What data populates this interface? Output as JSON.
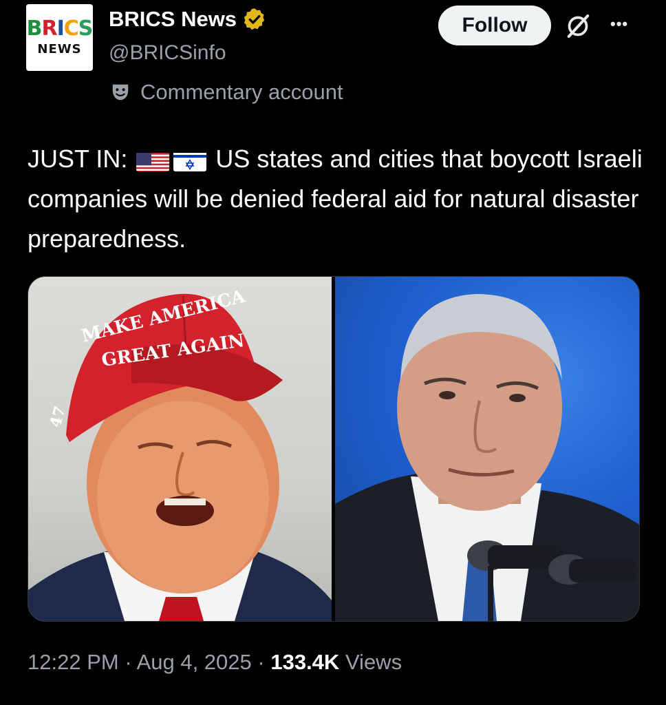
{
  "account": {
    "logo_line1": "BRICS",
    "logo_line2": "NEWS",
    "name": "BRICS News",
    "handle": "@BRICSinfo",
    "label": "Commentary account",
    "follow_label": "Follow"
  },
  "tweet": {
    "prefix": "JUST IN:",
    "text": "US states and cities that boycott Israeli companies will be denied federal aid for natural disaster preparedness.",
    "flags": [
      "us-flag-icon",
      "israel-flag-icon"
    ]
  },
  "media": {
    "cap_text_line1": "MAKE AMERICA",
    "cap_text_line2": "GREAT AGAIN",
    "cap_side": "47"
  },
  "meta": {
    "time": "12:22 PM",
    "sep1": "·",
    "date": "Aug 4, 2025",
    "sep2": "·",
    "views_count": "133.4K",
    "views_label": "Views"
  },
  "colors": {
    "background": "#000000",
    "verified": "#e2b719",
    "follow_bg": "#eff3f4",
    "muted": "#9aa1a8"
  }
}
